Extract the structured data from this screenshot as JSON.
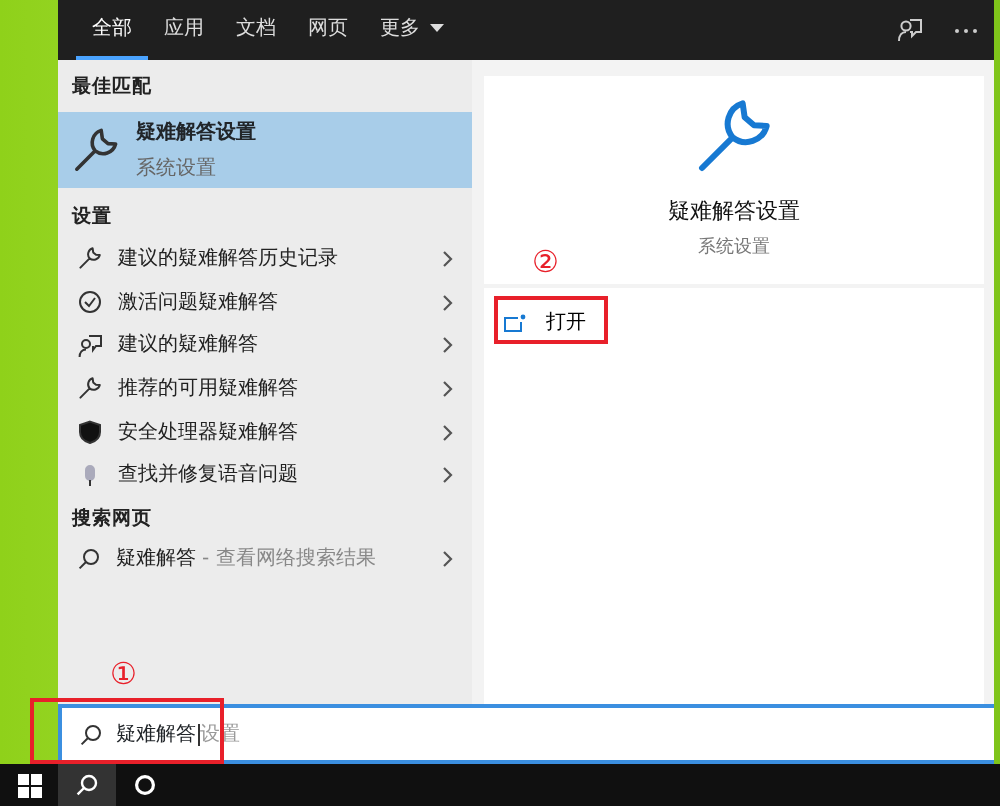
{
  "tabs": [
    {
      "label": "全部",
      "selected": true,
      "dropdown": false
    },
    {
      "label": "应用",
      "selected": false,
      "dropdown": false
    },
    {
      "label": "文档",
      "selected": false,
      "dropdown": false
    },
    {
      "label": "网页",
      "selected": false,
      "dropdown": false
    },
    {
      "label": "更多",
      "selected": false,
      "dropdown": true
    }
  ],
  "best_match": {
    "heading": "最佳匹配",
    "title": "疑难解答设置",
    "subtitle": "系统设置",
    "selected": true
  },
  "settings": {
    "heading": "设置",
    "items": [
      {
        "label": "建议的疑难解答历史记录",
        "kind": "wrench"
      },
      {
        "label": "激活问题疑难解答",
        "kind": "check"
      },
      {
        "label": "建议的疑难解答",
        "kind": "person"
      },
      {
        "label": "推荐的可用疑难解答",
        "kind": "wrench"
      },
      {
        "label": "安全处理器疑难解答",
        "kind": "shield"
      },
      {
        "label": "查找并修复语音问题",
        "kind": "mic"
      }
    ]
  },
  "web": {
    "heading": "搜索网页",
    "items": [
      {
        "query": "疑难解答",
        "hint": "- 查看网络搜索结果"
      }
    ]
  },
  "detail": {
    "title": "疑难解答设置",
    "subtitle": "系统设置",
    "actions": [
      {
        "label": "打开"
      }
    ]
  },
  "search": {
    "value": "疑难解答",
    "suggestion": "设置"
  },
  "annotations": [
    {
      "number": "①"
    },
    {
      "number": "②"
    }
  ]
}
